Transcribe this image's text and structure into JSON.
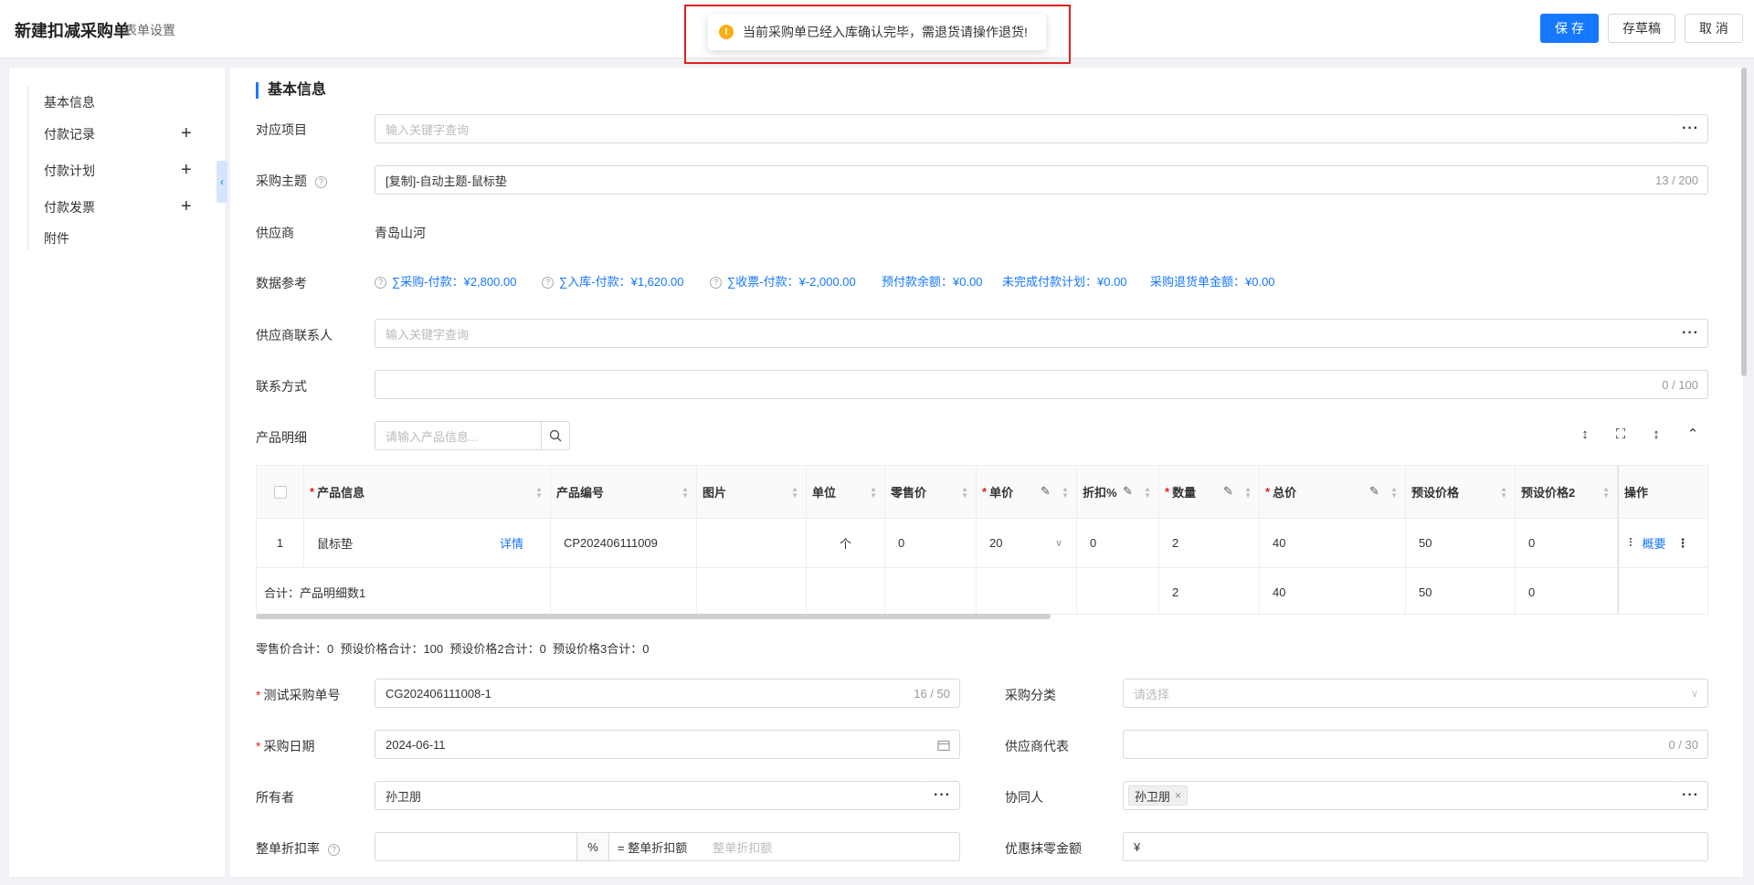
{
  "header": {
    "title": "新建扣减采购单",
    "form_settings": "表单设置",
    "save": "保 存",
    "draft": "存草稿",
    "cancel": "取 消"
  },
  "toast": {
    "message": "当前采购单已经入库确认完毕，需退货请操作退货!"
  },
  "sidebar": {
    "items": [
      "基本信息",
      "付款记录",
      "付款计划",
      "付款发票",
      "附件"
    ]
  },
  "section": {
    "basic_info": "基本信息"
  },
  "form": {
    "project": {
      "label": "对应项目",
      "placeholder": "输入关键字查询"
    },
    "subject": {
      "label": "采购主题",
      "value": "[复制]-自动主题-鼠标垫",
      "count": "13 / 200"
    },
    "supplier": {
      "label": "供应商",
      "value": "青岛山河"
    },
    "data_ref": {
      "label": "数据参考",
      "items": [
        "∑采购-付款：¥2,800.00",
        "∑入库-付款：¥1,620.00",
        "∑收票-付款：¥-2,000.00",
        "预付款余额：¥0.00",
        "未完成付款计划：¥0.00",
        "采购退货单金额：¥0.00"
      ]
    },
    "supplier_contact": {
      "label": "供应商联系人",
      "placeholder": "输入关键字查询"
    },
    "contact_method": {
      "label": "联系方式",
      "count": "0 / 100"
    },
    "product_detail": {
      "label": "产品明细",
      "search_placeholder": "请输入产品信息..."
    },
    "purchase_no": {
      "label": "测试采购单号",
      "value": "CG202406111008-1",
      "count": "16 / 50"
    },
    "purchase_category": {
      "label": "采购分类",
      "placeholder": "请选择"
    },
    "purchase_date": {
      "label": "采购日期",
      "value": "2024-06-11"
    },
    "supplier_rep": {
      "label": "供应商代表",
      "count": "0 / 30"
    },
    "owner": {
      "label": "所有者",
      "value": "孙卫朋"
    },
    "collaborator": {
      "label": "协同人",
      "tag": "孙卫朋"
    },
    "discount_rate": {
      "label": "整单折扣率",
      "unit": "%",
      "amount_label": "= 整单折扣额",
      "amount_placeholder": "整单折扣额"
    },
    "rounding": {
      "label": "优惠抹零金额",
      "symbol": "¥"
    }
  },
  "table": {
    "headers": [
      "产品信息",
      "产品编号",
      "图片",
      "单位",
      "零售价",
      "单价",
      "折扣%",
      "数量",
      "总价",
      "预设价格",
      "预设价格2",
      "操作"
    ],
    "row": {
      "index": "1",
      "name": "鼠标垫",
      "detail_link": "详情",
      "code": "CP202406111009",
      "unit": "个",
      "retail": "0",
      "price": "20",
      "discount": "0",
      "qty": "2",
      "total": "40",
      "preset": "50",
      "preset2": "0",
      "action_link": "概要"
    },
    "summary": {
      "label": "合计：产品明细数1",
      "qty": "2",
      "total": "40",
      "preset": "50",
      "preset2": "0"
    }
  },
  "totals_line": "零售价合计：0  预设价格合计：100  预设价格2合计：0  预设价格3合计：0"
}
